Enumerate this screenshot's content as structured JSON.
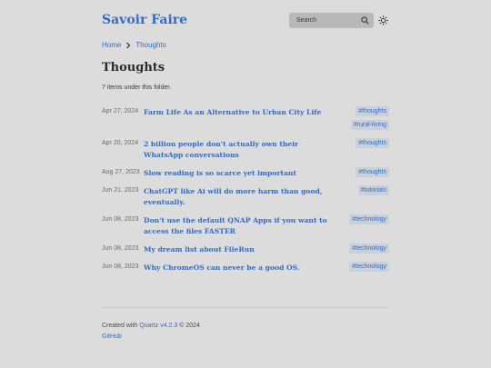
{
  "header": {
    "site_title": "Savoir Faire",
    "search_placeholder": "Search",
    "icons": {
      "search": "search-icon",
      "theme": "sun-icon"
    }
  },
  "breadcrumb": {
    "home": "Home",
    "current": "Thoughts"
  },
  "page": {
    "title": "Thoughts",
    "count_text": "7 items under this folder."
  },
  "items": [
    {
      "date": "Apr 27, 2024",
      "title": "Farm Life As an Alternative to Urban City Life",
      "tags": [
        "#thoughts",
        "#rural-living"
      ]
    },
    {
      "date": "Apr 20, 2024",
      "title": "2 billion people don't actually own their WhatsApp conversations",
      "tags": [
        "#thoughts"
      ]
    },
    {
      "date": "Aug 27, 2023",
      "title": "Slow reading is so scarce yet important",
      "tags": [
        "#thoughts"
      ]
    },
    {
      "date": "Jun 21, 2023",
      "title": "ChatGPT like Ai will do more harm than good, eventually.",
      "tags": [
        "#tutorials"
      ]
    },
    {
      "date": "Jun 08, 2023",
      "title": "Don't use the default QNAP Apps if you want to access the files FASTER",
      "tags": [
        "#technology"
      ]
    },
    {
      "date": "Jun 08, 2023",
      "title": "My dream list about FileRun",
      "tags": [
        "#technology"
      ]
    },
    {
      "date": "Jun 08, 2023",
      "title": "Why ChromeOS can never be a good OS.",
      "tags": [
        "#technology"
      ]
    }
  ],
  "footer": {
    "created_with": "Created with",
    "quartz_link": "Quartz v4.2.3",
    "copyright": "© 2024",
    "github_link": "GitHub"
  },
  "colors": {
    "background": "#dcdcdc",
    "accent": "#2f6cc9",
    "search_bg": "#b8b8b8",
    "tag_bg": "#c9d0d9"
  }
}
